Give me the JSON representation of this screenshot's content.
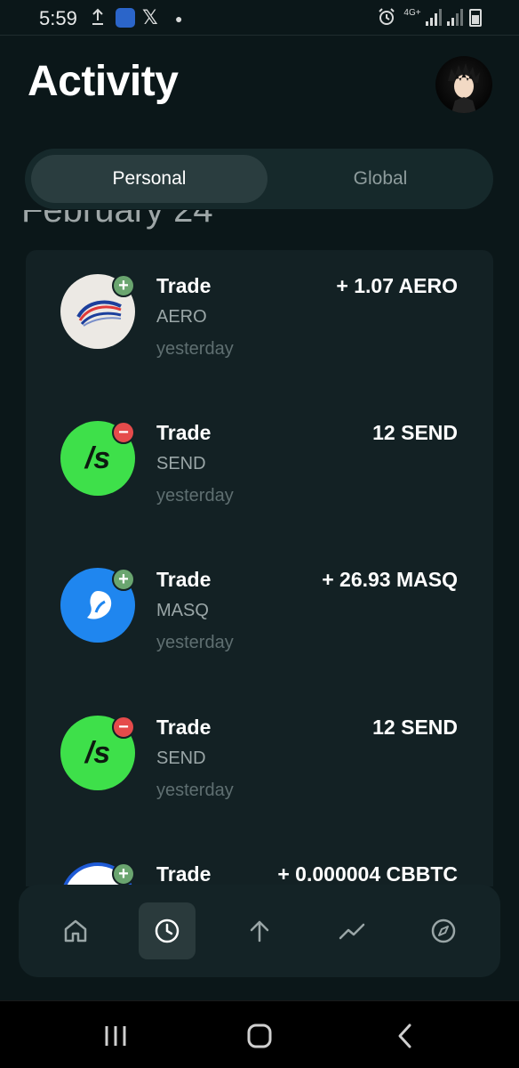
{
  "status_bar": {
    "time": "5:59",
    "network": "4G+",
    "icons": [
      "upload-icon",
      "app-icon",
      "x-icon",
      "dot-icon",
      "alarm-icon",
      "signal-icon",
      "signal-icon",
      "battery-icon"
    ]
  },
  "header": {
    "title": "Activity",
    "avatar": "profile-avatar"
  },
  "segmented": {
    "tabs": [
      {
        "label": "Personal",
        "active": true
      },
      {
        "label": "Global",
        "active": false
      }
    ]
  },
  "date_heading": "February 24",
  "activities": [
    {
      "type": "Trade",
      "token": "AERO",
      "time": "yesterday",
      "amount": "+ 1.07 AERO",
      "direction": "in",
      "logo": "aero-logo"
    },
    {
      "type": "Trade",
      "token": "SEND",
      "time": "yesterday",
      "amount": "12 SEND",
      "direction": "out",
      "logo": "send-logo",
      "logo_text": "/s"
    },
    {
      "type": "Trade",
      "token": "MASQ",
      "time": "yesterday",
      "amount": "+ 26.93 MASQ",
      "direction": "in",
      "logo": "masq-logo"
    },
    {
      "type": "Trade",
      "token": "SEND",
      "time": "yesterday",
      "amount": "12 SEND",
      "direction": "out",
      "logo": "send-logo",
      "logo_text": "/s"
    },
    {
      "type": "Trade",
      "token": "",
      "time": "",
      "amount": "+ 0.000004 CBBTC",
      "direction": "in",
      "logo": "cbbtc-logo"
    }
  ],
  "badges": {
    "in": "+",
    "out": "−"
  },
  "bottom_nav": [
    "home-icon",
    "activity-icon",
    "send-icon",
    "trade-icon",
    "explore-icon"
  ],
  "colors": {
    "background": "#0b1719",
    "card": "#132124",
    "badge_in": "#6aa56f",
    "badge_out": "#e54b4b",
    "send_green": "#3ee04a",
    "masq_blue": "#1f86ef"
  }
}
